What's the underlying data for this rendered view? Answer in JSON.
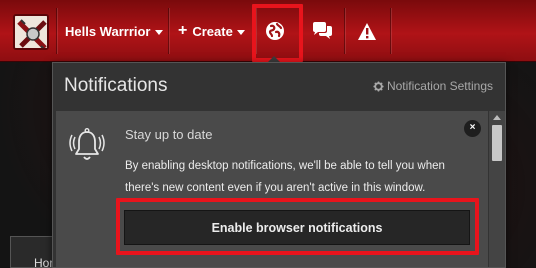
{
  "navbar": {
    "user_label": "Hells Warrrior",
    "create_label": "Create",
    "icons": [
      "globe-icon",
      "chat-bubbles-icon",
      "warning-icon"
    ],
    "brand_color": "#b01317",
    "highlight_color": "#e8141c"
  },
  "notifications": {
    "title": "Notifications",
    "settings_label": "Notification Settings",
    "notice": {
      "title": "Stay up to date",
      "text": "By enabling desktop notifications, we'll be able to tell you when there's new content even if you aren't active in this window.",
      "button_label": "Enable browser notifications",
      "close_label": "×"
    }
  },
  "background": {
    "breadcrumb_fragment": "Hor"
  }
}
